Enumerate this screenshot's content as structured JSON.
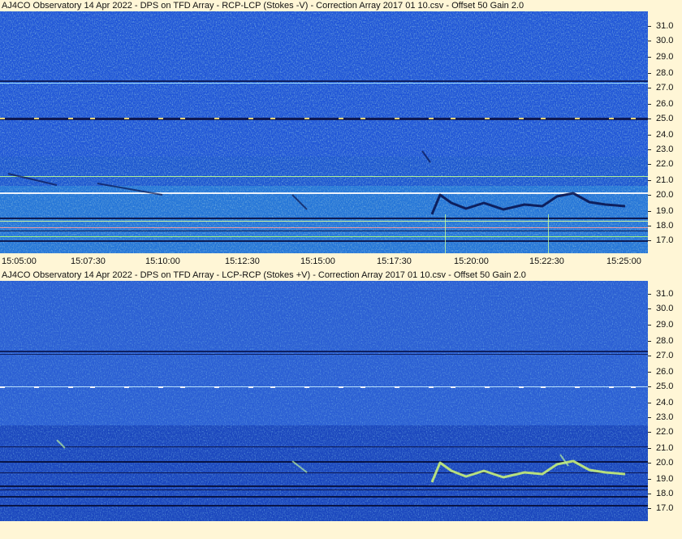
{
  "panels": [
    {
      "title": "AJ4CO Observatory 14 Apr 2022  -  DPS on TFD Array  -  RCP-LCP (Stokes -V)  -  Correction Array 2017 01 10.csv  -  Offset 50  Gain 2.0"
    },
    {
      "title": "AJ4CO Observatory 14 Apr 2022  -  DPS on TFD Array  -  LCP-RCP (Stokes +V)  -  Correction Array 2017 01 10.csv  -  Offset 50  Gain 2.0"
    }
  ],
  "y_labels": [
    "31.0",
    "30.0",
    "29.0",
    "28.0",
    "27.0",
    "26.0",
    "25.0",
    "24.0",
    "23.0",
    "22.0",
    "21.0",
    "20.0",
    "19.0",
    "18.0",
    "17.0"
  ],
  "x_labels": [
    "15:05:00",
    "15:07:30",
    "15:10:00",
    "15:12:30",
    "15:15:00",
    "15:17:30",
    "15:20:00",
    "15:22:30",
    "15:25:00"
  ],
  "colors": {
    "background": "#fff6d6",
    "spectrogram_base": "#1c4fd6",
    "burst_top": "#0a1550",
    "burst_bottom": "#c8f07a"
  }
}
